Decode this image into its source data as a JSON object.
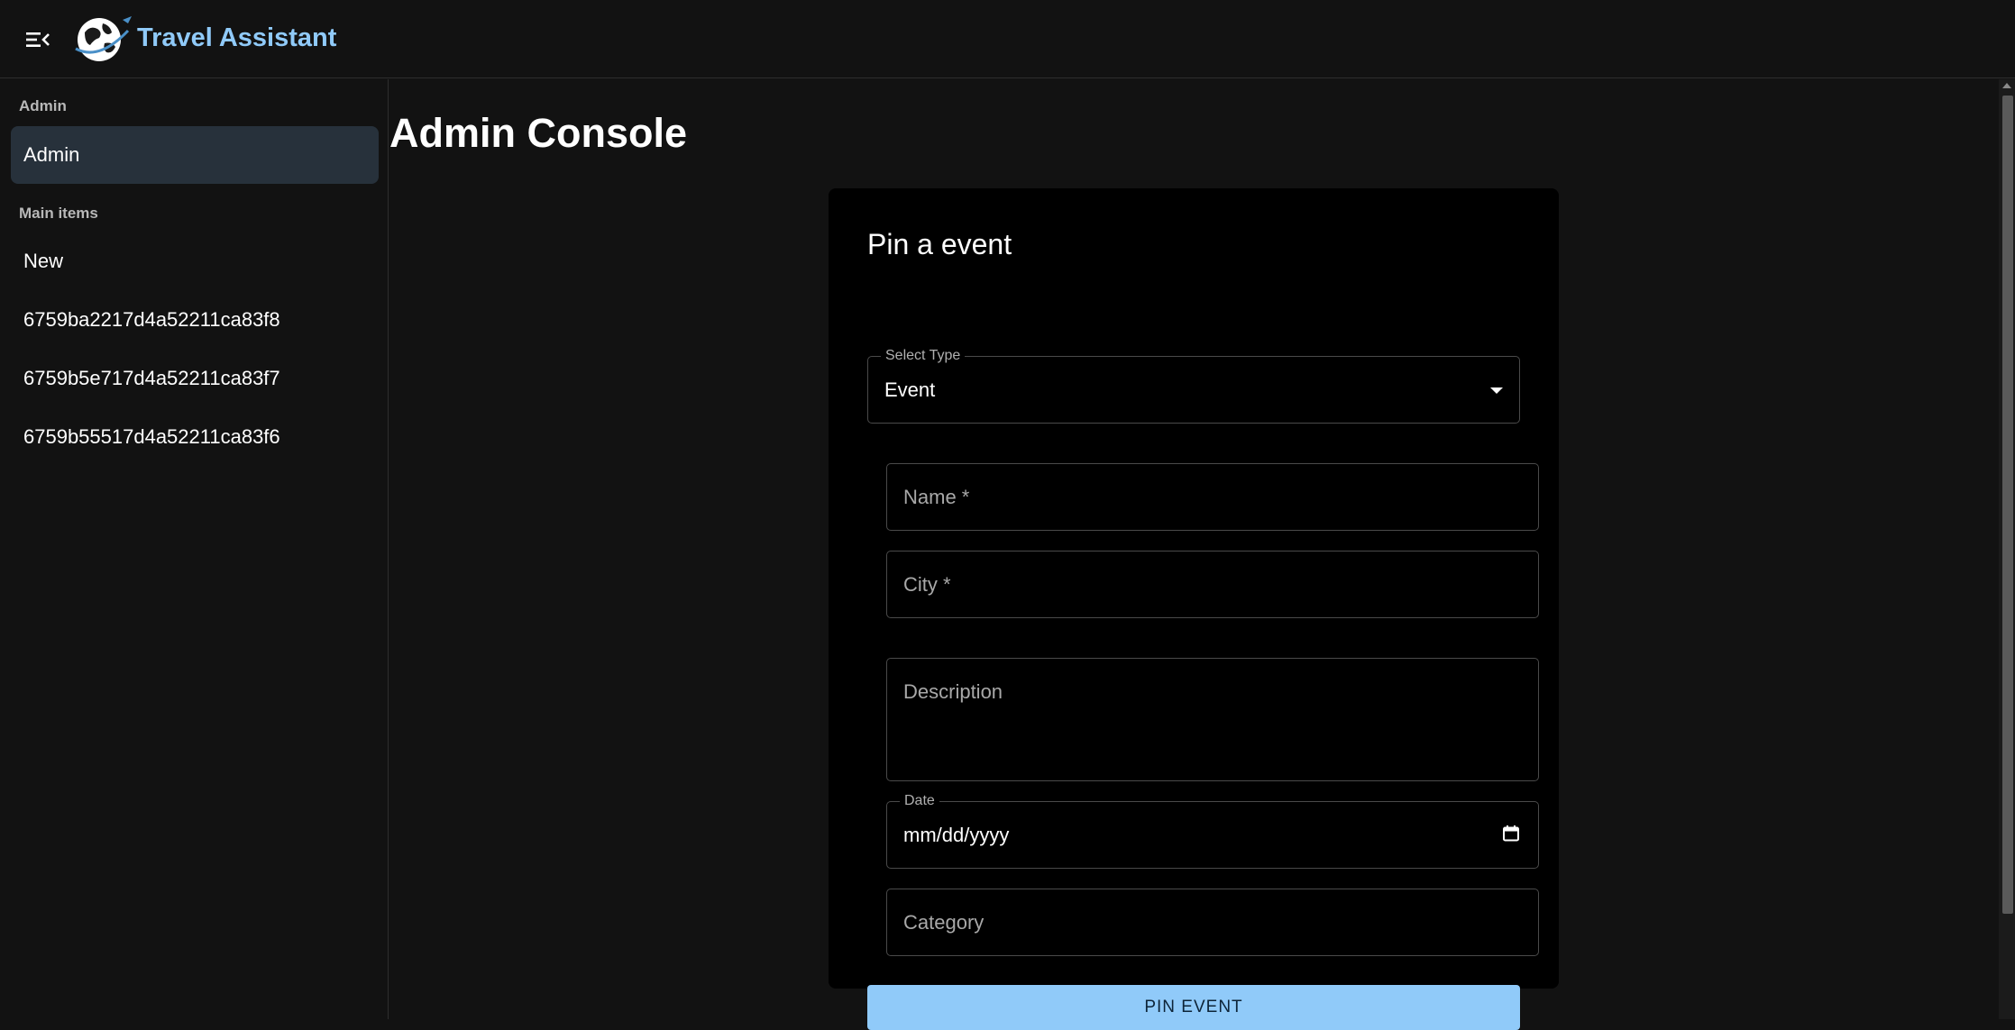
{
  "app": {
    "title": "Travel Assistant"
  },
  "header": {
    "menu_icon": "menu-open-icon",
    "logo_icon": "globe-airplane-logo"
  },
  "sidebar": {
    "sections": [
      {
        "label": "Admin",
        "items": [
          {
            "label": "Admin",
            "selected": true
          }
        ]
      },
      {
        "label": "Main items",
        "items": [
          {
            "label": "New"
          },
          {
            "label": "6759ba2217d4a52211ca83f8"
          },
          {
            "label": "6759b5e717d4a52211ca83f7"
          },
          {
            "label": "6759b55517d4a52211ca83f6"
          }
        ]
      }
    ]
  },
  "main": {
    "title": "Admin Console",
    "form": {
      "title": "Pin a event",
      "select_type": {
        "label": "Select Type",
        "value": "Event",
        "icon": "dropdown-arrow-icon"
      },
      "name": {
        "placeholder": "Name *"
      },
      "city": {
        "placeholder": "City *"
      },
      "description": {
        "placeholder": "Description"
      },
      "date": {
        "label": "Date",
        "value": "mm/dd/yyyy",
        "icon": "calendar-icon"
      },
      "category": {
        "placeholder": "Category"
      },
      "submit_label": "PIN EVENT"
    }
  },
  "colors": {
    "background": "#121212",
    "card": "#000000",
    "accent": "#90caf9",
    "selected_item": "#27313b"
  }
}
